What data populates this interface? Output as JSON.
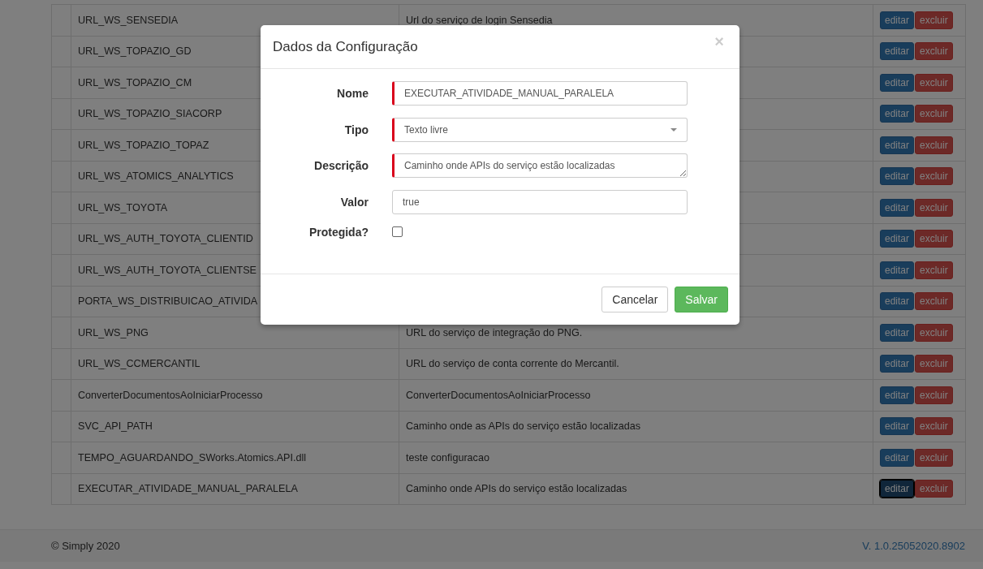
{
  "table": {
    "rows": [
      {
        "name": "URL_WS_SENSEDIA",
        "description": "Url do serviço de login Sensedia",
        "edit": "editar",
        "delete": "excluir",
        "focused": false
      },
      {
        "name": "URL_WS_TOPAZIO_GD",
        "edit": "editar",
        "delete": "excluir",
        "focused": false
      },
      {
        "name": "URL_WS_TOPAZIO_CM",
        "edit": "editar",
        "delete": "excluir",
        "focused": false
      },
      {
        "name": "URL_WS_TOPAZIO_SIACORP",
        "edit": "editar",
        "delete": "excluir",
        "focused": false
      },
      {
        "name": "URL_WS_TOPAZIO_TOPAZ",
        "edit": "editar",
        "delete": "excluir",
        "focused": false
      },
      {
        "name": "URL_WS_ATOMICS_ANALYTICS",
        "edit": "editar",
        "delete": "excluir",
        "focused": false
      },
      {
        "name": "URL_WS_TOYOTA",
        "edit": "editar",
        "delete": "excluir",
        "focused": false
      },
      {
        "name": "URL_WS_AUTH_TOYOTA_CLIENTID",
        "edit": "editar",
        "delete": "excluir",
        "focused": false
      },
      {
        "name": "URL_WS_AUTH_TOYOTA_CLIENTSE",
        "edit": "editar",
        "delete": "excluir",
        "focused": false
      },
      {
        "name": "PORTA_WS_DISTRIBUICAO_ATIVIDA",
        "edit": "editar",
        "delete": "excluir",
        "focused": false
      },
      {
        "name": "URL_WS_PNG",
        "description": "URL do serviço de integração do PNG.",
        "edit": "editar",
        "delete": "excluir",
        "focused": false
      },
      {
        "name": "URL_WS_CCMERCANTIL",
        "description": "URL do serviço de conta corrente do Mercantil.",
        "edit": "editar",
        "delete": "excluir",
        "focused": false
      },
      {
        "name": "ConverterDocumentosAoIniciarProcesso",
        "description": "ConverterDocumentosAoIniciarProcesso",
        "edit": "editar",
        "delete": "excluir",
        "focused": false
      },
      {
        "name": "SVC_API_PATH",
        "description": "Caminho onde as APIs do serviço estão localizadas",
        "edit": "editar",
        "delete": "excluir",
        "focused": false
      },
      {
        "name": "TEMPO_AGUARDANDO_SWorks.Atomics.API.dll",
        "description": "teste configuracao",
        "edit": "editar",
        "delete": "excluir",
        "focused": false
      },
      {
        "name": "EXECUTAR_ATIVIDADE_MANUAL_PARALELA",
        "description": "Caminho onde APIs do serviço estão localizadas",
        "edit": "editar",
        "delete": "excluir",
        "focused": true
      }
    ]
  },
  "footer": {
    "copyright": "© Simply 2020",
    "version": "V. 1.0.25052020.8902"
  },
  "modal": {
    "title": "Dados da Configuração",
    "close": "×",
    "fields": [
      {
        "kind": "text",
        "label": "Nome",
        "value": "EXECUTAR_ATIVIDADE_MANUAL_PARALELA",
        "required": true
      },
      {
        "kind": "select",
        "label": "Tipo",
        "value": "Texto livre",
        "required": true
      },
      {
        "kind": "textarea",
        "label": "Descrição",
        "value": "Caminho onde APIs do serviço estão localizadas",
        "required": true
      },
      {
        "kind": "text",
        "label": "Valor",
        "value": "true",
        "required": false
      },
      {
        "kind": "checkbox",
        "label": "Protegida?",
        "checked": false
      }
    ],
    "buttons": [
      {
        "label": "Cancelar",
        "kind": "default"
      },
      {
        "label": "Salvar",
        "kind": "success"
      }
    ]
  }
}
